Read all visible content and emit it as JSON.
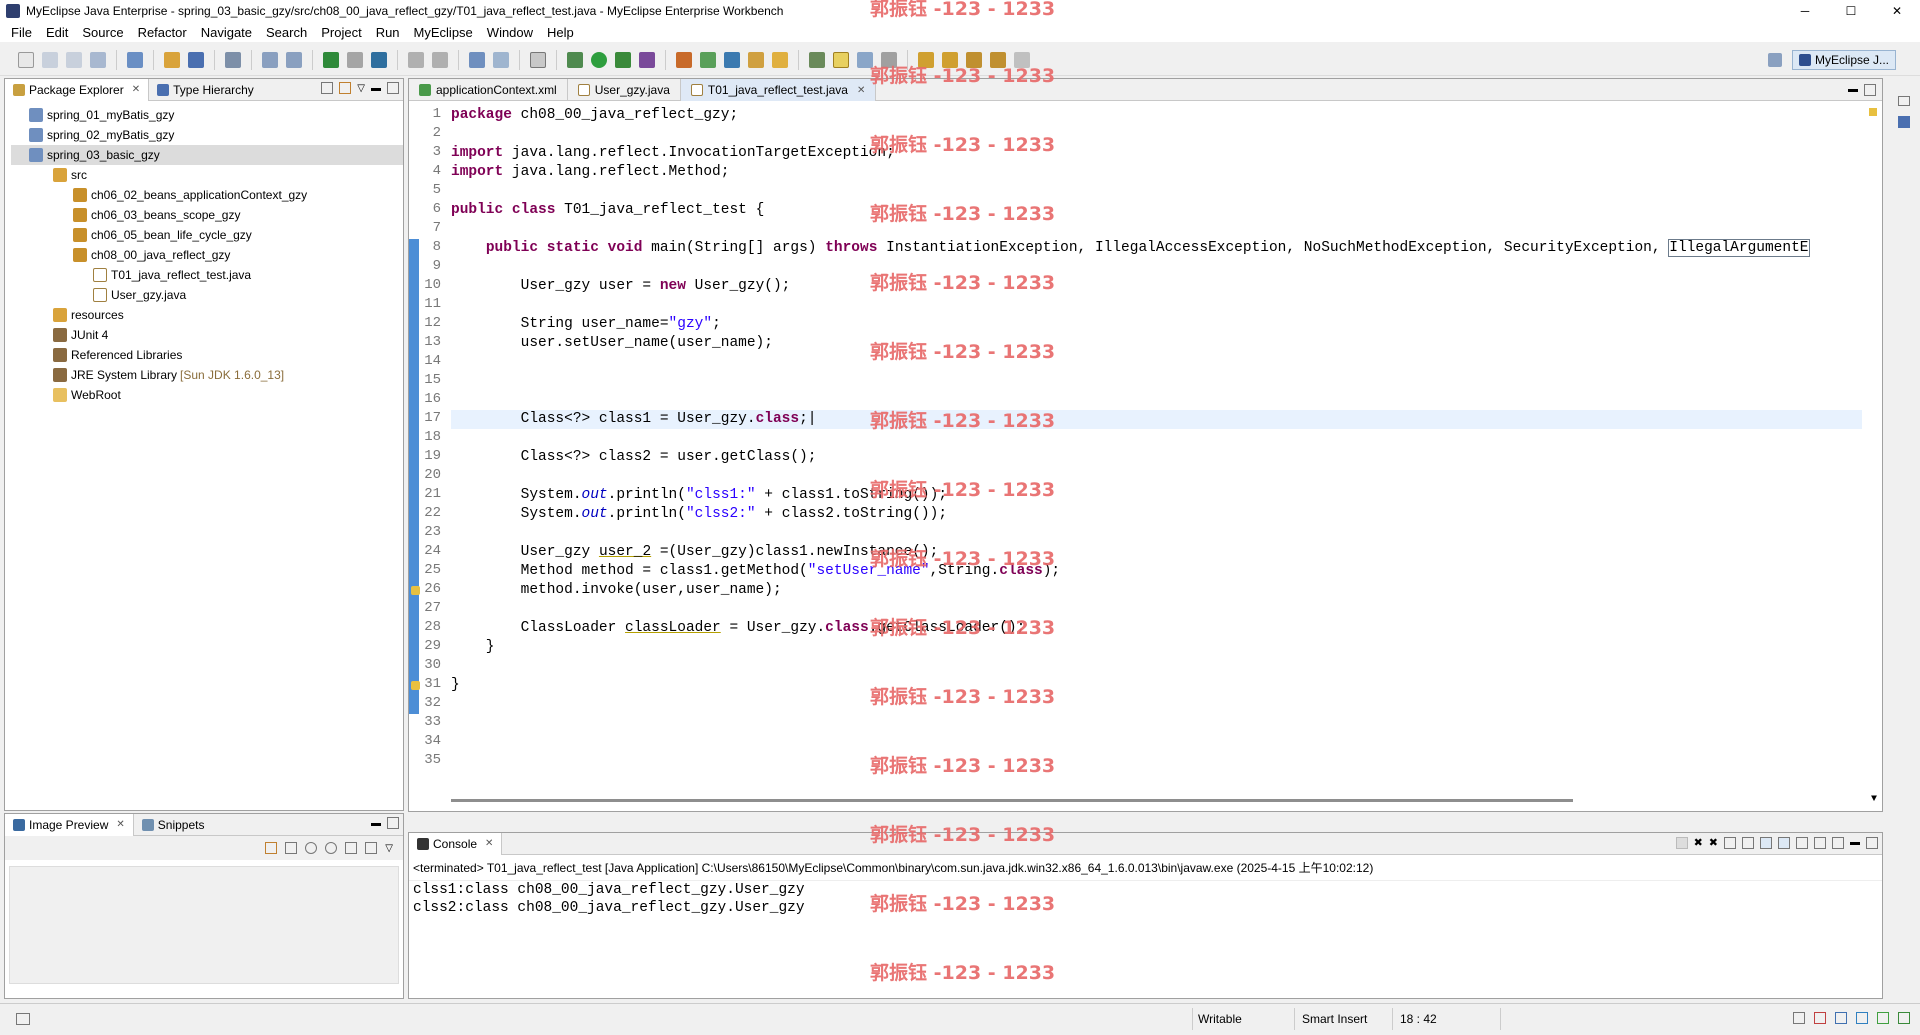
{
  "window": {
    "title": "MyEclipse Java Enterprise - spring_03_basic_gzy/src/ch08_00_java_reflect_gzy/T01_java_reflect_test.java - MyEclipse Enterprise Workbench",
    "minimize": "─",
    "maximize": "☐",
    "close": "✕"
  },
  "menu": [
    "File",
    "Edit",
    "Source",
    "Refactor",
    "Navigate",
    "Search",
    "Project",
    "Run",
    "MyEclipse",
    "Window",
    "Help"
  ],
  "perspective": {
    "label": "MyEclipse J..."
  },
  "package_explorer": {
    "tab_label": "Package Explorer",
    "tab2_label": "Type Hierarchy",
    "items": [
      {
        "label": "spring_01_myBatis_gzy",
        "deco": ""
      },
      {
        "label": "spring_02_myBatis_gzy",
        "deco": ""
      },
      {
        "label": "spring_03_basic_gzy",
        "deco": ""
      },
      {
        "label": "src",
        "deco": ""
      },
      {
        "label": "ch06_02_beans_applicationContext_gzy",
        "deco": ""
      },
      {
        "label": "ch06_03_beans_scope_gzy",
        "deco": ""
      },
      {
        "label": "ch06_05_bean_life_cycle_gzy",
        "deco": ""
      },
      {
        "label": "ch08_00_java_reflect_gzy",
        "deco": ""
      },
      {
        "label": "T01_java_reflect_test.java",
        "deco": ""
      },
      {
        "label": "User_gzy.java",
        "deco": ""
      },
      {
        "label": "resources",
        "deco": ""
      },
      {
        "label": "JUnit 4",
        "deco": ""
      },
      {
        "label": "Referenced Libraries",
        "deco": ""
      },
      {
        "label": "JRE System Library",
        "deco": "[Sun JDK 1.6.0_13]"
      },
      {
        "label": "WebRoot",
        "deco": ""
      }
    ]
  },
  "image_preview": {
    "tab_label": "Image Preview",
    "tab2_label": "Snippets"
  },
  "editor": {
    "tabs": [
      {
        "label": "applicationContext.xml"
      },
      {
        "label": "User_gzy.java"
      },
      {
        "label": "T01_java_reflect_test.java"
      }
    ],
    "line_numbers": [
      "1",
      "2",
      "3",
      "4",
      "5",
      "6",
      "7",
      "8",
      "9",
      "10",
      "11",
      "12",
      "13",
      "14",
      "15",
      "16",
      "17",
      "18",
      "19",
      "20",
      "21",
      "22",
      "23",
      "24",
      "25",
      "26",
      "27",
      "28",
      "29",
      "30",
      "31",
      "32",
      "33",
      "34",
      "35"
    ],
    "current_line": 18
  },
  "console": {
    "tab_label": "Console",
    "info": "<terminated> T01_java_reflect_test [Java Application] C:\\Users\\86150\\MyEclipse\\Common\\binary\\com.sun.java.jdk.win32.x86_64_1.6.0.013\\bin\\javaw.exe (2025-4-15 上午10:02:12)",
    "lines": [
      "clss1:class ch08_00_java_reflect_gzy.User_gzy",
      "clss2:class ch08_00_java_reflect_gzy.User_gzy"
    ]
  },
  "status": {
    "writable": "Writable",
    "insert_mode": "Smart Insert",
    "position": "18 : 42"
  },
  "watermark": "郭振钰 -123 - 1233",
  "colors": {
    "keyword": "#7f0055",
    "string": "#2a00ff",
    "field": "#0000c0",
    "watermark": "#e86a6a",
    "marker_blue": "#4d8ed6"
  }
}
